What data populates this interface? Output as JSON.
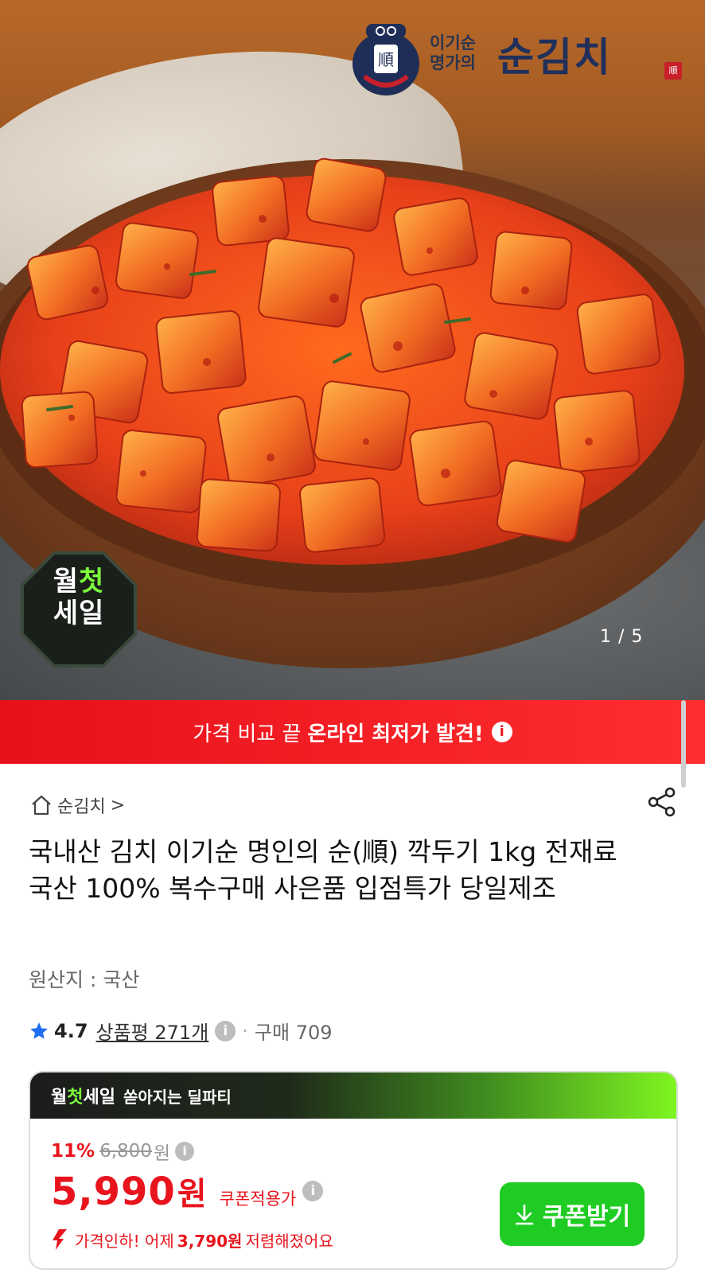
{
  "hero": {
    "logo_sub_line1": "이기순",
    "logo_sub_line2": "명가의",
    "logo_main": "순김치",
    "logo_seal": "順",
    "sale_badge_line1_a": "월",
    "sale_badge_line1_b": "첫",
    "sale_badge_line2": "세일",
    "image_counter": "1 / 5"
  },
  "banner": {
    "text_plain": "가격 비교 끝",
    "text_strong": "온라인 최저가 발견!",
    "info_icon": "i"
  },
  "breadcrumb": {
    "label": "순김치",
    "chevron": ">"
  },
  "product": {
    "title": "국내산 김치 이기순 명인의 순(順) 깍두기 1kg 전재료 국산 100% 복수구매 사은품 입점특가 당일제조",
    "origin": "원산지 : 국산",
    "rating_score": "4.7",
    "reviews": "상품평 271개",
    "info_icon": "i",
    "separator": "·",
    "purchases": "구매 709"
  },
  "deal": {
    "header_a": "월",
    "header_b": "첫",
    "header_c": "세일",
    "header_sub": "쏟아지는 딜파티",
    "discount_pct": "11%",
    "original_price": "6,800",
    "won_small": "원",
    "price": "5,990",
    "price_unit": "원",
    "coupon_note": "쿠폰적용가",
    "drop_prefix": "가격인하! 어제",
    "drop_amount": "3,790원",
    "drop_suffix": "저렴해졌어요",
    "coupon_button": "쿠폰받기"
  },
  "colors": {
    "accent_red": "#e8141d",
    "accent_green": "#1fcc24",
    "badge_green": "#7dff3d"
  },
  "icons": [
    "home-icon",
    "chevron-right-icon",
    "share-icon",
    "star-icon",
    "info-icon",
    "download-icon",
    "arrow-down-icon"
  ]
}
